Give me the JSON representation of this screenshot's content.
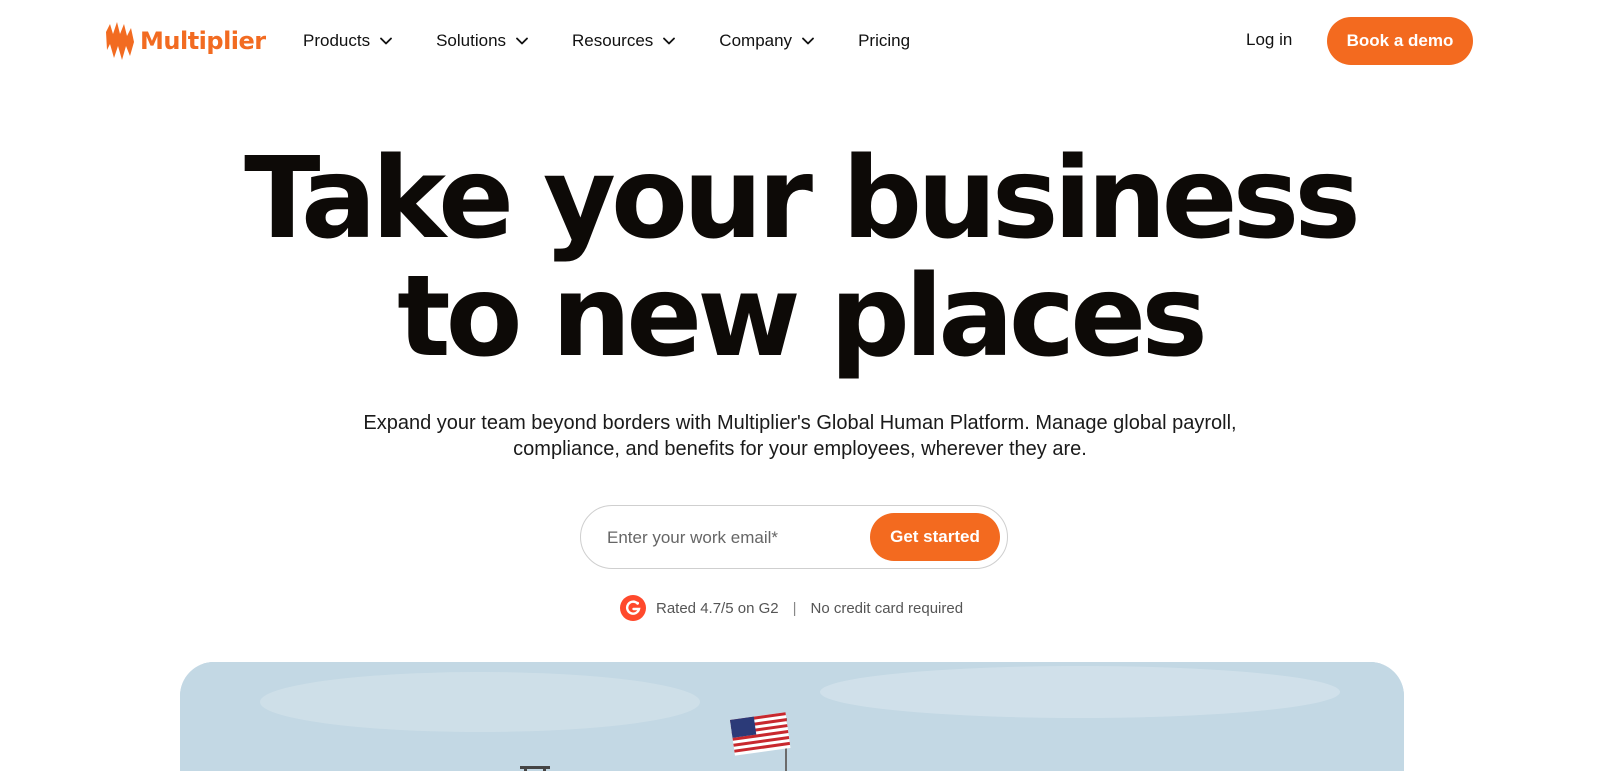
{
  "header": {
    "logo": {
      "text": "Multiplier",
      "icon": "multiplier-logo-icon"
    },
    "nav": [
      {
        "label": "Products",
        "has_dropdown": true
      },
      {
        "label": "Solutions",
        "has_dropdown": true
      },
      {
        "label": "Resources",
        "has_dropdown": true
      },
      {
        "label": "Company",
        "has_dropdown": true
      },
      {
        "label": "Pricing",
        "has_dropdown": false
      }
    ],
    "login_label": "Log in",
    "demo_label": "Book a demo"
  },
  "hero": {
    "title_line1": "Take your business",
    "title_line2": "to new places",
    "subtitle": "Expand your team beyond borders with Multiplier's Global Human Platform. Manage global payroll, compliance, and benefits for your employees, wherever they are.",
    "email_placeholder": "Enter your work email*",
    "cta_label": "Get started",
    "rating_text": "Rated 4.7/5 on G2",
    "separator": "|",
    "no_card_text": "No credit card required",
    "rating_icon": "g2-icon"
  },
  "colors": {
    "accent": "#f36a1f",
    "title": "#0d0a07",
    "g2": "#ff492c"
  }
}
